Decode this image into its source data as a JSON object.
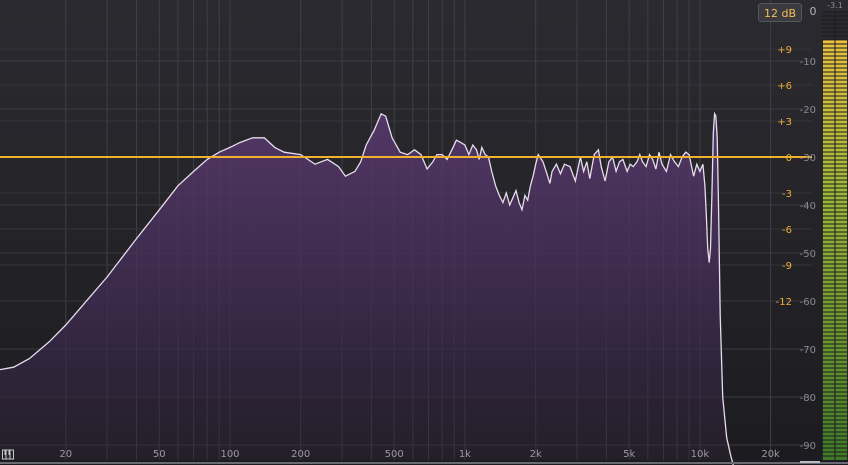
{
  "toolbar": {
    "range_label": "12 dB"
  },
  "meter": {
    "peak_value": "-3.1",
    "zero_label": "0",
    "level": 0.93
  },
  "freq_axis": {
    "labels": [
      {
        "hz": 20,
        "text": "20"
      },
      {
        "hz": 50,
        "text": "50"
      },
      {
        "hz": 100,
        "text": "100"
      },
      {
        "hz": 200,
        "text": "200"
      },
      {
        "hz": 500,
        "text": "500"
      },
      {
        "hz": 1000,
        "text": "1k"
      },
      {
        "hz": 2000,
        "text": "2k"
      },
      {
        "hz": 5000,
        "text": "5k"
      },
      {
        "hz": 10000,
        "text": "10k"
      },
      {
        "hz": 20000,
        "text": "20k"
      }
    ],
    "gridlines_hz": [
      20,
      30,
      40,
      50,
      60,
      70,
      80,
      90,
      100,
      200,
      300,
      400,
      500,
      600,
      700,
      800,
      900,
      1000,
      2000,
      3000,
      4000,
      5000,
      6000,
      7000,
      8000,
      9000,
      10000,
      20000
    ],
    "min_hz": 10.5,
    "max_hz": 30000
  },
  "gain_axis": {
    "labels": [
      {
        "db": 9,
        "text": "+9"
      },
      {
        "db": 6,
        "text": "+6"
      },
      {
        "db": 3,
        "text": "+3"
      },
      {
        "db": 0,
        "text": "0"
      },
      {
        "db": -3,
        "text": "-3"
      },
      {
        "db": -6,
        "text": "-6"
      },
      {
        "db": -9,
        "text": "-9"
      },
      {
        "db": -12,
        "text": "-12"
      }
    ],
    "color": "#f0b030"
  },
  "spectrum_axis": {
    "labels": [
      {
        "db": -10,
        "text": "-10"
      },
      {
        "db": -20,
        "text": "-20"
      },
      {
        "db": -30,
        "text": "-30"
      },
      {
        "db": -40,
        "text": "-40"
      },
      {
        "db": -50,
        "text": "-50"
      },
      {
        "db": -60,
        "text": "-60"
      },
      {
        "db": -70,
        "text": "-70"
      },
      {
        "db": -80,
        "text": "-80"
      },
      {
        "db": -90,
        "text": "-90"
      }
    ]
  },
  "eq_curve": {
    "gain_db": 0,
    "color": "#f0b030"
  },
  "spectrum": {
    "line_color": "#e6dcec",
    "fill_color": "#5a3a70",
    "points": [
      [
        10.5,
        -74.3
      ],
      [
        12,
        -73.8
      ],
      [
        14,
        -72
      ],
      [
        17,
        -68.5
      ],
      [
        20,
        -65
      ],
      [
        25,
        -59.5
      ],
      [
        30,
        -55
      ],
      [
        40,
        -47
      ],
      [
        50,
        -41
      ],
      [
        60,
        -36
      ],
      [
        70,
        -33
      ],
      [
        80,
        -30.5
      ],
      [
        90,
        -29
      ],
      [
        100,
        -28
      ],
      [
        110,
        -27
      ],
      [
        125,
        -26
      ],
      [
        140,
        -26
      ],
      [
        155,
        -28
      ],
      [
        170,
        -29
      ],
      [
        200,
        -29.5
      ],
      [
        230,
        -31.5
      ],
      [
        260,
        -30.5
      ],
      [
        290,
        -32
      ],
      [
        310,
        -34
      ],
      [
        340,
        -33
      ],
      [
        360,
        -31
      ],
      [
        380,
        -27.5
      ],
      [
        410,
        -24.5
      ],
      [
        440,
        -21
      ],
      [
        460,
        -21.5
      ],
      [
        490,
        -26
      ],
      [
        530,
        -29
      ],
      [
        570,
        -29.5
      ],
      [
        610,
        -28.5
      ],
      [
        650,
        -29.5
      ],
      [
        690,
        -32.5
      ],
      [
        730,
        -31
      ],
      [
        760,
        -29.5
      ],
      [
        800,
        -29.5
      ],
      [
        840,
        -30.5
      ],
      [
        880,
        -28.5
      ],
      [
        920,
        -26.5
      ],
      [
        960,
        -27
      ],
      [
        1000,
        -27.5
      ],
      [
        1040,
        -29.5
      ],
      [
        1080,
        -27.5
      ],
      [
        1120,
        -28.5
      ],
      [
        1150,
        -30.5
      ],
      [
        1180,
        -28
      ],
      [
        1220,
        -29.5
      ],
      [
        1260,
        -30
      ],
      [
        1300,
        -33
      ],
      [
        1350,
        -36
      ],
      [
        1400,
        -38
      ],
      [
        1450,
        -39.5
      ],
      [
        1500,
        -37.5
      ],
      [
        1550,
        -40
      ],
      [
        1600,
        -38.5
      ],
      [
        1650,
        -37
      ],
      [
        1700,
        -39.5
      ],
      [
        1750,
        -41
      ],
      [
        1800,
        -38
      ],
      [
        1850,
        -39
      ],
      [
        1900,
        -36
      ],
      [
        1950,
        -34
      ],
      [
        2000,
        -31.5
      ],
      [
        2050,
        -29.5
      ],
      [
        2150,
        -31
      ],
      [
        2250,
        -34
      ],
      [
        2300,
        -35.5
      ],
      [
        2350,
        -33
      ],
      [
        2450,
        -31.5
      ],
      [
        2550,
        -33.5
      ],
      [
        2650,
        -31.5
      ],
      [
        2800,
        -32
      ],
      [
        2950,
        -35
      ],
      [
        3100,
        -30
      ],
      [
        3200,
        -33
      ],
      [
        3300,
        -31
      ],
      [
        3400,
        -34.5
      ],
      [
        3550,
        -29.5
      ],
      [
        3700,
        -28.5
      ],
      [
        3800,
        -32
      ],
      [
        3950,
        -35
      ],
      [
        4100,
        -31
      ],
      [
        4250,
        -30
      ],
      [
        4400,
        -33
      ],
      [
        4550,
        -31
      ],
      [
        4700,
        -30.5
      ],
      [
        4900,
        -33
      ],
      [
        5050,
        -31.5
      ],
      [
        5200,
        -32
      ],
      [
        5400,
        -31
      ],
      [
        5550,
        -29.5
      ],
      [
        5700,
        -31
      ],
      [
        5900,
        -32
      ],
      [
        6100,
        -29.5
      ],
      [
        6300,
        -30.5
      ],
      [
        6500,
        -32.5
      ],
      [
        6700,
        -29
      ],
      [
        6900,
        -31.5
      ],
      [
        7200,
        -33
      ],
      [
        7500,
        -29.5
      ],
      [
        7800,
        -31
      ],
      [
        8100,
        -32
      ],
      [
        8400,
        -30
      ],
      [
        8700,
        -29
      ],
      [
        9000,
        -29.5
      ],
      [
        9400,
        -34
      ],
      [
        9700,
        -31.5
      ],
      [
        10000,
        -33
      ],
      [
        10300,
        -31.5
      ],
      [
        10500,
        -36
      ],
      [
        10650,
        -42
      ],
      [
        10800,
        -49
      ],
      [
        10950,
        -52
      ],
      [
        11100,
        -49
      ],
      [
        11250,
        -38
      ],
      [
        11400,
        -25
      ],
      [
        11550,
        -21
      ],
      [
        11700,
        -21.5
      ],
      [
        11850,
        -26
      ],
      [
        12000,
        -40
      ],
      [
        12200,
        -63
      ],
      [
        12500,
        -80
      ],
      [
        13000,
        -88.5
      ],
      [
        13500,
        -92
      ],
      [
        14000,
        -95
      ],
      [
        15000,
        -99
      ]
    ]
  }
}
